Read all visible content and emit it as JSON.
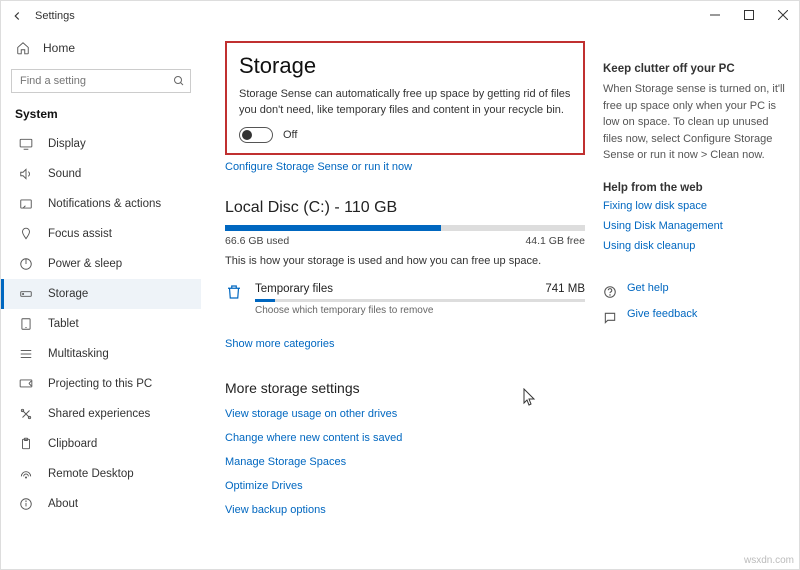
{
  "window": {
    "app_name": "Settings",
    "buttons": {
      "minimize": "—",
      "maximize": "□",
      "close": "✕"
    }
  },
  "sidebar": {
    "home": "Home",
    "search_placeholder": "Find a setting",
    "category": "System",
    "items": [
      {
        "label": "Display",
        "icon": "display-icon"
      },
      {
        "label": "Sound",
        "icon": "sound-icon"
      },
      {
        "label": "Notifications & actions",
        "icon": "notifications-icon"
      },
      {
        "label": "Focus assist",
        "icon": "focus-icon"
      },
      {
        "label": "Power & sleep",
        "icon": "power-icon"
      },
      {
        "label": "Storage",
        "icon": "storage-icon"
      },
      {
        "label": "Tablet",
        "icon": "tablet-icon"
      },
      {
        "label": "Multitasking",
        "icon": "multitask-icon"
      },
      {
        "label": "Projecting to this PC",
        "icon": "projecting-icon"
      },
      {
        "label": "Shared experiences",
        "icon": "shared-icon"
      },
      {
        "label": "Clipboard",
        "icon": "clipboard-icon"
      },
      {
        "label": "Remote Desktop",
        "icon": "remote-icon"
      },
      {
        "label": "About",
        "icon": "about-icon"
      }
    ]
  },
  "page": {
    "title": "Storage",
    "description": "Storage Sense can automatically free up space by getting rid of files you don't need, like temporary files and content in your recycle bin.",
    "toggle_state": "Off",
    "configure_link": "Configure Storage Sense or run it now",
    "disk": {
      "title": "Local Disc (C:) - 110 GB",
      "used_label": "66.6 GB used",
      "free_label": "44.1 GB free",
      "fill_pct": 60
    },
    "hint": "This is how your storage is used and how you can free up space.",
    "temp": {
      "name": "Temporary files",
      "size": "741 MB",
      "choose": "Choose which temporary files to remove"
    },
    "show_more": "Show more categories",
    "more_section": "More storage settings",
    "more_links": [
      "View storage usage on other drives",
      "Change where new content is saved",
      "Manage Storage Spaces",
      "Optimize Drives",
      "View backup options"
    ]
  },
  "right": {
    "keep_clutter": {
      "heading": "Keep clutter off your PC",
      "body": "When Storage sense is turned on, it'll free up space only when your PC is low on space. To clean up unused files now, select Configure Storage Sense or run it now > Clean now."
    },
    "help_heading": "Help from the web",
    "help_links": [
      "Fixing low disk space",
      "Using Disk Management",
      "Using disk cleanup"
    ],
    "get_help": "Get help",
    "give_feedback": "Give feedback"
  },
  "watermark": "wsxdn.com"
}
